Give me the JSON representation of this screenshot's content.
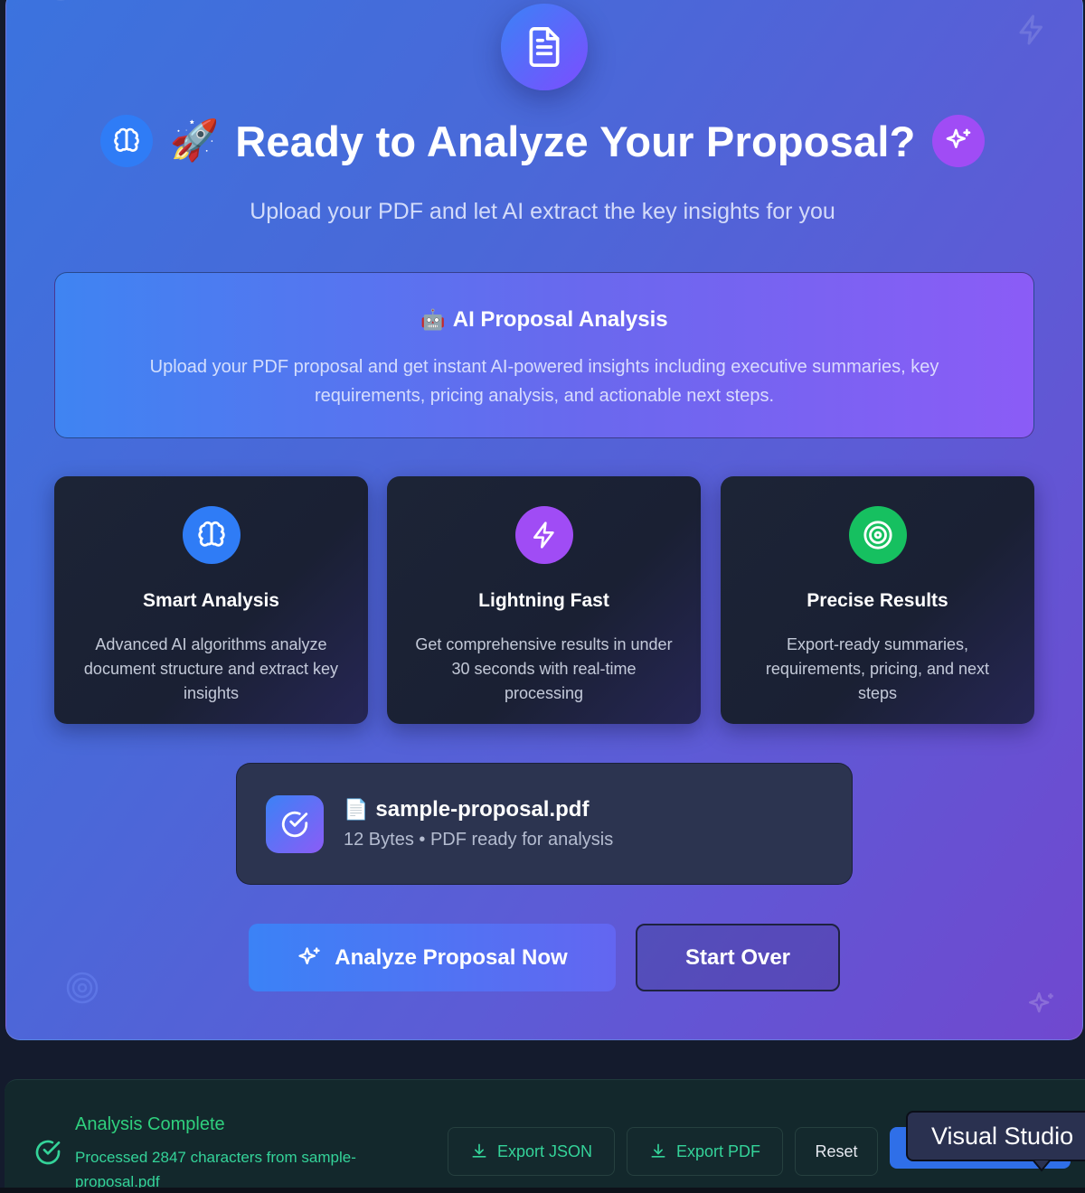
{
  "header": {
    "title": "Ready to Analyze Your Proposal?",
    "title_emoji": "🚀",
    "subtitle": "Upload your PDF and let AI extract the key insights for you",
    "top_icon": "document-icon",
    "left_badge_icon": "brain-icon",
    "right_badge_icon": "sparkles-icon"
  },
  "info_banner": {
    "emoji": "🤖",
    "title": "AI Proposal Analysis",
    "description": "Upload your PDF proposal and get instant AI-powered insights including executive summaries, key requirements, pricing analysis, and actionable next steps."
  },
  "features": [
    {
      "icon": "brain-icon",
      "color": "#2f7cf6",
      "title": "Smart Analysis",
      "description": "Advanced AI algorithms analyze document structure and extract key insights"
    },
    {
      "icon": "lightning-icon",
      "color": "#a04cf5",
      "title": "Lightning Fast",
      "description": "Get comprehensive results in under 30 seconds with real-time processing"
    },
    {
      "icon": "target-icon",
      "color": "#16c060",
      "title": "Precise Results",
      "description": "Export-ready summaries, requirements, pricing, and next steps"
    }
  ],
  "file": {
    "emoji": "📄",
    "name": "sample-proposal.pdf",
    "meta": "12 Bytes • PDF ready for analysis"
  },
  "actions": {
    "analyze_label": "Analyze Proposal Now",
    "start_over_label": "Start Over"
  },
  "status_bar": {
    "title": "Analysis Complete",
    "description": "Processed 2847 characters from sample-proposal.pdf",
    "export_json_label": "Export JSON",
    "export_pdf_label": "Export PDF",
    "reset_label": "Reset"
  },
  "tooltip": {
    "text": "Visual Studio"
  },
  "colors": {
    "accent_blue": "#3b82f6",
    "accent_purple": "#8b5cf6",
    "success_green": "#34d399"
  }
}
